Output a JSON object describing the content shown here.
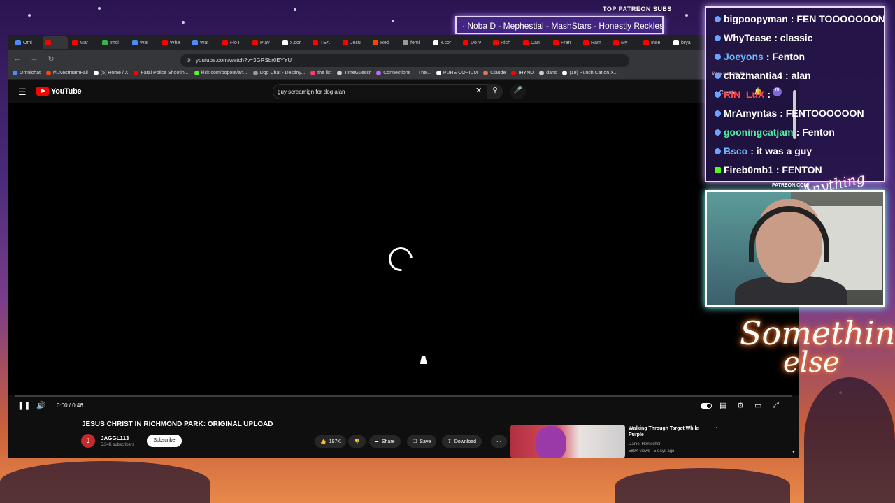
{
  "overlay": {
    "now_playing_header": "TOP PATREON SUBS",
    "now_playing_text": "·  Noba D - Mephestial - MashStars - Honestly Reckless - A",
    "patreon_url": "PATREON.COM/",
    "neon_sign_line1": "Something",
    "neon_sign_line2": "else",
    "anything_text": "Anything"
  },
  "chat": {
    "messages": [
      {
        "user": "bigpoopyman",
        "text": ": FEN TOOOOOOON",
        "color": "#ffffff",
        "badge": "blue"
      },
      {
        "user": "WhyTease",
        "text": ": classic",
        "color": "#ffffff",
        "badge": "blue"
      },
      {
        "user": "Joeyons",
        "text": ": Fenton",
        "color": "#6fb6ff",
        "badge": "blue"
      },
      {
        "user": "chazmantia4",
        "text": ": alan",
        "color": "#ffffff",
        "badge": "blue"
      },
      {
        "user": "RiN_LuX",
        "text": ":",
        "color": "#ff4a4a",
        "badge": "blue"
      },
      {
        "user": "MrAmyntas",
        "text": ": FENTOOOOOON",
        "color": "#ffffff",
        "badge": "blue"
      },
      {
        "user": "gooningcatjam",
        "text": ": Fenton",
        "color": "#4ff0a0",
        "badge": "blue"
      },
      {
        "user": "Bsco",
        "text": ": it was a guy",
        "color": "#6fb6ff",
        "badge": "blue"
      },
      {
        "user": "Fireb0mb1",
        "text": ": FENTON",
        "color": "#ffffff",
        "badge": "kick"
      }
    ],
    "tooltip": "Many Men but it's s...",
    "create_label": "Create",
    "avatar_letter": "m"
  },
  "browser": {
    "tabs": [
      {
        "label": "Omi",
        "color": "#4a8cff"
      },
      {
        "label": "",
        "color": "#ff0000"
      },
      {
        "label": "Mar",
        "color": "#ff0000"
      },
      {
        "label": "Imcl",
        "color": "#3bb54a"
      },
      {
        "label": "Wat",
        "color": "#4a8cff"
      },
      {
        "label": "Whe",
        "color": "#ff0000"
      },
      {
        "label": "Wat",
        "color": "#4a8cff"
      },
      {
        "label": "Flo I",
        "color": "#ff0000"
      },
      {
        "label": "Play",
        "color": "#ff0000"
      },
      {
        "label": "x.cor",
        "color": "#ffffff"
      },
      {
        "label": "TEA",
        "color": "#ff0000"
      },
      {
        "label": "Jesu",
        "color": "#ff0000"
      },
      {
        "label": "Red",
        "color": "#ff4500"
      },
      {
        "label": "femi",
        "color": "#999999"
      },
      {
        "label": "x.cor",
        "color": "#ffffff"
      },
      {
        "label": "Do V",
        "color": "#ff0000"
      },
      {
        "label": "Rich",
        "color": "#ff0000"
      },
      {
        "label": "Dani",
        "color": "#ff0000"
      },
      {
        "label": "Fran",
        "color": "#ff0000"
      },
      {
        "label": "Ram",
        "color": "#ff0000"
      },
      {
        "label": "My",
        "color": "#ff0000"
      },
      {
        "label": "Inse",
        "color": "#ff0000"
      },
      {
        "label": "brya",
        "color": "#ffffff"
      }
    ],
    "url": "youtube.com/watch?v=3GRSbr0EYYU",
    "bookmarks": [
      {
        "label": "Omnichat",
        "color": "#4a8cff"
      },
      {
        "label": "r/LivestreamFail",
        "color": "#ff4500"
      },
      {
        "label": "(5) Home / X",
        "color": "#ffffff"
      },
      {
        "label": "Fatal Police Shootin...",
        "color": "#ff0000"
      },
      {
        "label": "kick.com/popout/an...",
        "color": "#53fc18"
      },
      {
        "label": "Dgg Chat - Destiny...",
        "color": "#999999"
      },
      {
        "label": "the list",
        "color": "#ff3a6a"
      },
      {
        "label": "TimeGuessr",
        "color": "#cccccc"
      },
      {
        "label": "Connections — The...",
        "color": "#b46cff"
      },
      {
        "label": "PURE COPIUM",
        "color": "#ffffff"
      },
      {
        "label": "Claude",
        "color": "#d97757"
      },
      {
        "label": "IHYND",
        "color": "#ff0000"
      },
      {
        "label": "dans",
        "color": "#cccccc"
      },
      {
        "label": "(19) Punch Cat on X...",
        "color": "#ffffff"
      }
    ]
  },
  "youtube": {
    "logo_text": "YouTube",
    "search_value": "guy screamign for dog alan",
    "time": "0:00 / 0:46",
    "video_title": "JESUS CHRIST IN RICHMOND PARK: ORIGINAL UPLOAD",
    "channel_initial": "J",
    "channel_name": "JAGGL113",
    "channel_subs": "5.34K subscribers",
    "subscribe_label": "Subscribe",
    "like_count": "197K",
    "share_label": "Share",
    "save_label": "Save",
    "download_label": "Download",
    "recommended": {
      "title": "Walking Through Target While Purple",
      "channel": "Daniel Hentschel",
      "meta": "589K views · 5 days ago"
    }
  }
}
